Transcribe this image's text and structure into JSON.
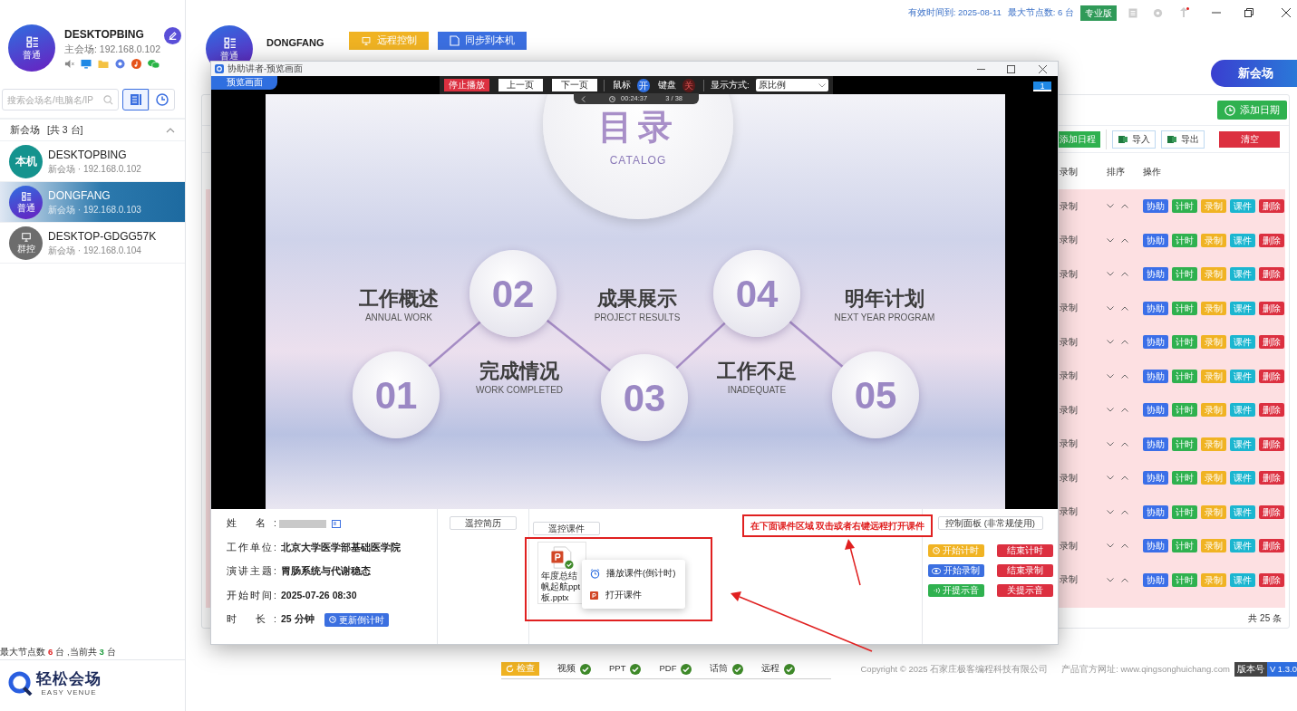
{
  "sidebar": {
    "profile": {
      "avatar_label": "普通",
      "name": "DESKTOPBING",
      "subtitle": "主会场: 192.168.0.102"
    },
    "search": {
      "placeholder": "搜索会场名/电脑名/IP"
    },
    "view_buttons": [
      {
        "selected": true
      },
      {
        "selected": false
      }
    ],
    "group": {
      "title": "新会场",
      "count": "[共 3 台]",
      "expanded": true
    },
    "items": [
      {
        "avatar_label": "本机",
        "kind": "local",
        "name": "DESKTOPBING",
        "subtitle": "新会场 · 192.168.0.102",
        "selected": false
      },
      {
        "avatar_label": "普通",
        "kind": "normal",
        "name": "DONGFANG",
        "subtitle": "新会场 · 192.168.0.103",
        "selected": true
      },
      {
        "avatar_label": "群控",
        "kind": "group",
        "name": "DESKTOP-GDGG57K",
        "subtitle": "新会场 · 192.168.0.104",
        "selected": false
      }
    ],
    "footer": {
      "max_label": "最大节点数",
      "max": "6",
      "mid": "台 ,当前共",
      "current": "3",
      "unit": "台"
    },
    "logo": {
      "name": "轻松会场",
      "tagline": "EASY VENUE"
    }
  },
  "top_bar": {
    "expiry": "有效时间到: 2025-08-11",
    "nodes": "最大节点数: 6 台",
    "edition": "专业版"
  },
  "header": {
    "avatar_label": "普通",
    "name": "DONGFANG",
    "buttons": [
      "远程控制",
      "同步到本机"
    ],
    "new_venue": "新会场"
  },
  "schedule": {
    "add_date": "添加日期",
    "toolbar": [
      "添加日程",
      "导入",
      "导出",
      "清空"
    ],
    "columns": [
      "录制",
      "排序",
      "操作"
    ],
    "rows": [
      {
        "status": "录制",
        "actions": [
          "协助",
          "计时",
          "录制",
          "课件",
          "删除"
        ]
      },
      {
        "status": "录制",
        "actions": [
          "协助",
          "计时",
          "录制",
          "课件",
          "删除"
        ]
      },
      {
        "status": "录制",
        "actions": [
          "协助",
          "计时",
          "录制",
          "课件",
          "删除"
        ]
      },
      {
        "status": "录制",
        "actions": [
          "协助",
          "计时",
          "录制",
          "课件",
          "删除"
        ]
      },
      {
        "status": "录制",
        "actions": [
          "协助",
          "计时",
          "录制",
          "课件",
          "删除"
        ]
      },
      {
        "status": "录制",
        "actions": [
          "协助",
          "计时",
          "录制",
          "课件",
          "删除"
        ]
      },
      {
        "status": "录制",
        "actions": [
          "协助",
          "计时",
          "录制",
          "课件",
          "删除"
        ]
      },
      {
        "status": "录制",
        "actions": [
          "协助",
          "计时",
          "录制",
          "课件",
          "删除"
        ]
      },
      {
        "status": "录制",
        "actions": [
          "协助",
          "计时",
          "录制",
          "课件",
          "删除"
        ]
      },
      {
        "status": "录制",
        "actions": [
          "协助",
          "计时",
          "录制",
          "课件",
          "删除"
        ]
      },
      {
        "status": "录制",
        "actions": [
          "协助",
          "计时",
          "录制",
          "课件",
          "删除"
        ]
      },
      {
        "status": "录制",
        "actions": [
          "协助",
          "计时",
          "录制",
          "课件",
          "删除"
        ]
      }
    ],
    "total": "共 25 条"
  },
  "status_bar": {
    "check": "检查",
    "checks": [
      {
        "label": "视频",
        "ok": true
      },
      {
        "label": "PPT",
        "ok": true
      },
      {
        "label": "PDF",
        "ok": true
      },
      {
        "label": "话筒",
        "ok": true
      },
      {
        "label": "远程",
        "ok": true
      }
    ],
    "copyright": "Copyright © 2025 石家庄极客编程科技有限公司",
    "website": "产品官方网址: www.qingsonghuichang.com",
    "version_label": "版本号",
    "version": "V 1.3.0"
  },
  "dialog": {
    "title": "协助讲者-预览画面",
    "tab": "预览画面",
    "controls": {
      "stop": "停止播放",
      "prev": "上一页",
      "next": "下一页",
      "toggles": [
        {
          "label": "鼠标",
          "state": "开",
          "on": true
        },
        {
          "label": "键盘",
          "state": "关",
          "on": false
        }
      ],
      "display_label": "显示方式:",
      "display_value": "原比例"
    },
    "timer": "00:24:37",
    "page": "3 / 38",
    "screen_badge": "1",
    "slide": {
      "title": "目录",
      "subtitle": "CATALOG",
      "numbers": [
        "02",
        "04",
        "01",
        "03",
        "05"
      ],
      "headings": [
        {
          "title": "工作概述",
          "subtitle": "ANNUAL WORK"
        },
        {
          "title": "成果展示",
          "subtitle": "PROJECT RESULTS"
        },
        {
          "title": "明年计划",
          "subtitle": "NEXT YEAR PROGRAM"
        },
        {
          "title": "完成情况",
          "subtitle": "WORK COMPLETED"
        },
        {
          "title": "工作不足",
          "subtitle": "INADEQUATE"
        }
      ]
    },
    "info": [
      {
        "label": "姓 名:",
        "kind": "redacted"
      },
      {
        "label": "工作单位:",
        "kind": "text",
        "value": "北京大学医学部基础医学院"
      },
      {
        "label": "演讲主题:",
        "kind": "text",
        "value": "胃肠系统与代谢稳态"
      },
      {
        "label": "开始时间:",
        "kind": "text",
        "value": "2025-07-26 08:30"
      },
      {
        "label": "时 长:",
        "kind": "text",
        "value": "25 分钟",
        "action": "更新倒计时"
      }
    ],
    "resume_button": "遥控简历",
    "files_button": "遥控课件",
    "hint": "在下面课件区域 双击或者右键远程打开课件",
    "file": {
      "name_lines": [
        "年度总结",
        "帆起航ppt",
        "板.pptx"
      ],
      "synced": true
    },
    "context_menu": [
      {
        "label": "播放课件(倒计时)",
        "kind": "play"
      },
      {
        "label": "打开课件",
        "kind": "open"
      }
    ],
    "control_panel": {
      "title": "控制面板 (非常规使用)",
      "buttons": [
        {
          "label": "开始计时",
          "kind": "timer"
        },
        {
          "label": "结束计时",
          "kind": "stop"
        },
        {
          "label": "开始录制",
          "kind": "record"
        },
        {
          "label": "结束录制",
          "kind": "stop"
        },
        {
          "label": "开提示音",
          "kind": "sound"
        },
        {
          "label": "关提示音",
          "kind": "stop"
        }
      ]
    }
  }
}
